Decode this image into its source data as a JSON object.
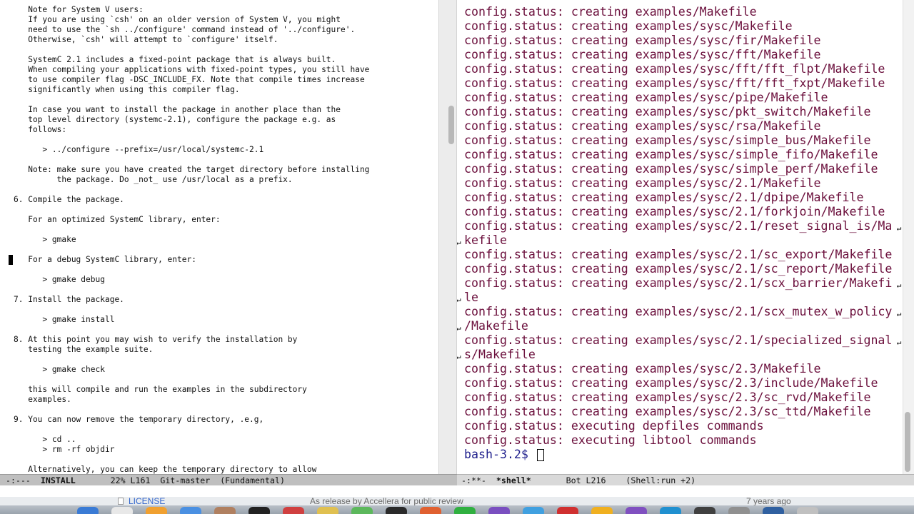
{
  "left_buffer": {
    "lines": [
      "   Note for System V users:",
      "   If you are using `csh' on an older version of System V, you might",
      "   need to use the `sh ../configure' command instead of '../configure'.",
      "   Otherwise, `csh' will attempt to `configure' itself.",
      "",
      "   SystemC 2.1 includes a fixed-point package that is always built.",
      "   When compiling your applications with fixed-point types, you still have",
      "   to use compiler flag -DSC_INCLUDE_FX. Note that compile times increase",
      "   significantly when using this compiler flag.",
      "",
      "   In case you want to install the package in another place than the",
      "   top level directory (systemc-2.1), configure the package e.g. as",
      "   follows:",
      "",
      "      > ../configure --prefix=/usr/local/systemc-2.1",
      "",
      "   Note: make sure you have created the target directory before installing",
      "         the package. Do _not_ use /usr/local as a prefix.",
      "",
      "6. Compile the package.",
      "",
      "   For an optimized SystemC library, enter:",
      "",
      "      > gmake",
      "",
      "   For a debug SystemC library, enter:",
      "",
      "      > gmake debug",
      "",
      "7. Install the package.",
      "",
      "      > gmake install",
      "",
      "8. At this point you may wish to verify the installation by",
      "   testing the example suite.",
      "",
      "      > gmake check",
      "",
      "   this will compile and run the examples in the subdirectory",
      "   examples.",
      "",
      "9. You can now remove the temporary directory, .e.g,",
      "",
      "      > cd ..",
      "      > rm -rf objdir",
      "",
      "   Alternatively, you can keep the temporary directory to allow"
    ]
  },
  "right_buffer": {
    "lines": [
      {
        "text": "config.status: creating examples/Makefile"
      },
      {
        "text": "config.status: creating examples/sysc/Makefile"
      },
      {
        "text": "config.status: creating examples/sysc/fir/Makefile"
      },
      {
        "text": "config.status: creating examples/sysc/fft/Makefile"
      },
      {
        "text": "config.status: creating examples/sysc/fft/fft_flpt/Makefile"
      },
      {
        "text": "config.status: creating examples/sysc/fft/fft_fxpt/Makefile"
      },
      {
        "text": "config.status: creating examples/sysc/pipe/Makefile"
      },
      {
        "text": "config.status: creating examples/sysc/pkt_switch/Makefile"
      },
      {
        "text": "config.status: creating examples/sysc/rsa/Makefile"
      },
      {
        "text": "config.status: creating examples/sysc/simple_bus/Makefile"
      },
      {
        "text": "config.status: creating examples/sysc/simple_fifo/Makefile"
      },
      {
        "text": "config.status: creating examples/sysc/simple_perf/Makefile"
      },
      {
        "text": "config.status: creating examples/sysc/2.1/Makefile"
      },
      {
        "text": "config.status: creating examples/sysc/2.1/dpipe/Makefile"
      },
      {
        "text": "config.status: creating examples/sysc/2.1/forkjoin/Makefile"
      },
      {
        "text": "config.status: creating examples/sysc/2.1/reset_signal_is/Ma",
        "wrap": "right"
      },
      {
        "text": "kefile",
        "wrap": "left"
      },
      {
        "text": "config.status: creating examples/sysc/2.1/sc_export/Makefile"
      },
      {
        "text": "config.status: creating examples/sysc/2.1/sc_report/Makefile"
      },
      {
        "text": "config.status: creating examples/sysc/2.1/scx_barrier/Makefi",
        "wrap": "right"
      },
      {
        "text": "le",
        "wrap": "left"
      },
      {
        "text": "config.status: creating examples/sysc/2.1/scx_mutex_w_policy",
        "wrap": "right"
      },
      {
        "text": "/Makefile",
        "wrap": "left"
      },
      {
        "text": "config.status: creating examples/sysc/2.1/specialized_signal",
        "wrap": "right"
      },
      {
        "text": "s/Makefile",
        "wrap": "left"
      },
      {
        "text": "config.status: creating examples/sysc/2.3/Makefile"
      },
      {
        "text": "config.status: creating examples/sysc/2.3/include/Makefile"
      },
      {
        "text": "config.status: creating examples/sysc/2.3/sc_rvd/Makefile"
      },
      {
        "text": "config.status: creating examples/sysc/2.3/sc_ttd/Makefile"
      },
      {
        "text": "config.status: executing depfiles commands"
      },
      {
        "text": "config.status: executing libtool commands"
      }
    ],
    "prompt": "bash-3.2$ "
  },
  "modeline_left": {
    "status": "-:---  ",
    "buffer": "INSTALL",
    "position": "       22% L161  ",
    "vc": "Git-master  ",
    "mode": "(Fundamental)"
  },
  "modeline_right": {
    "status": "-:**-  ",
    "buffer": "*shell*",
    "position": "       Bot L216    ",
    "mode": "(Shell:run +2)"
  },
  "background_window": {
    "file": "LICENSE",
    "message": "As release by Accellera for public review",
    "age": "7 years ago"
  },
  "icons": {
    "wrap": "wrap-arrow-icon",
    "file": "file-icon"
  },
  "colors": {
    "terminal_text": "#6b0f3c",
    "prompt": "#1e1e8c",
    "modeline_active": "#bfbfbf",
    "modeline_inactive": "#d9d9d9"
  }
}
